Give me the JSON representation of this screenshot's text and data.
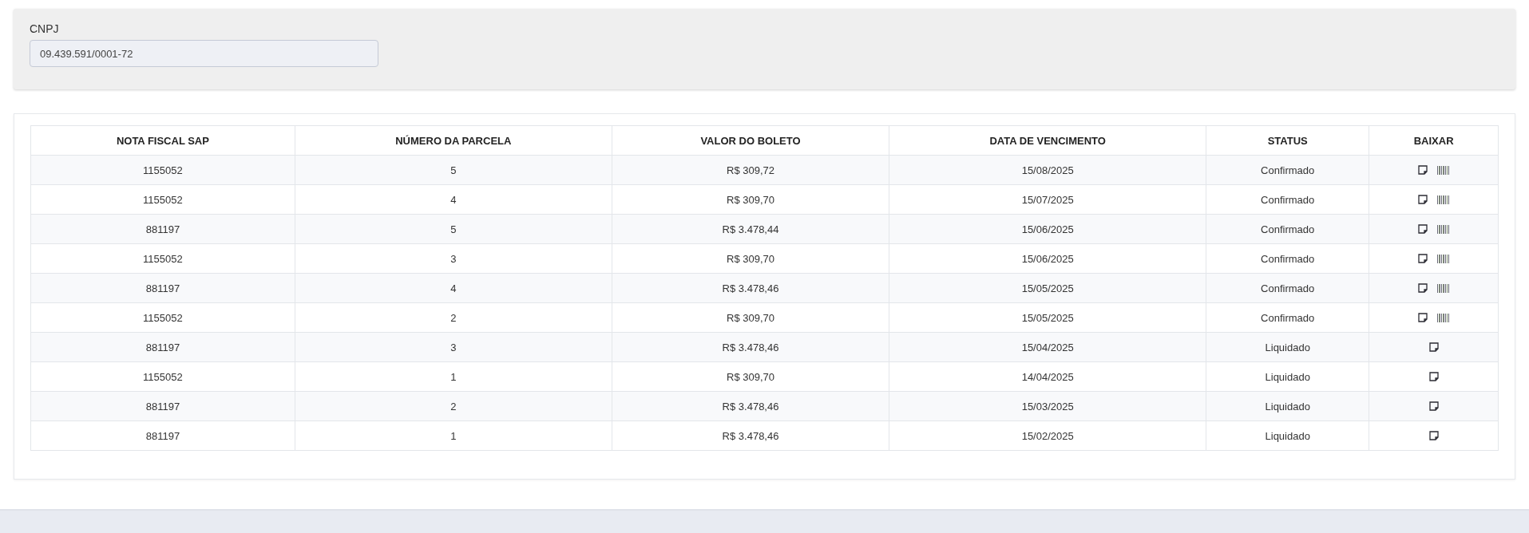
{
  "filter": {
    "label": "CNPJ",
    "value": "09.439.591/0001-72"
  },
  "table": {
    "columns": [
      "NOTA FISCAL SAP",
      "NÚMERO DA PARCELA",
      "VALOR DO BOLETO",
      "DATA DE VENCIMENTO",
      "STATUS",
      "BAIXAR"
    ],
    "rows": [
      {
        "cells": [
          "1155052",
          "5",
          "R$ 309,72",
          "15/08/2025",
          "Confirmado"
        ],
        "barcode": true
      },
      {
        "cells": [
          "1155052",
          "4",
          "R$ 309,70",
          "15/07/2025",
          "Confirmado"
        ],
        "barcode": true
      },
      {
        "cells": [
          "881197",
          "5",
          "R$ 3.478,44",
          "15/06/2025",
          "Confirmado"
        ],
        "barcode": true
      },
      {
        "cells": [
          "1155052",
          "3",
          "R$ 309,70",
          "15/06/2025",
          "Confirmado"
        ],
        "barcode": true
      },
      {
        "cells": [
          "881197",
          "4",
          "R$ 3.478,46",
          "15/05/2025",
          "Confirmado"
        ],
        "barcode": true
      },
      {
        "cells": [
          "1155052",
          "2",
          "R$ 309,70",
          "15/05/2025",
          "Confirmado"
        ],
        "barcode": true
      },
      {
        "cells": [
          "881197",
          "3",
          "R$ 3.478,46",
          "15/04/2025",
          "Liquidado"
        ],
        "barcode": false
      },
      {
        "cells": [
          "1155052",
          "1",
          "R$ 309,70",
          "14/04/2025",
          "Liquidado"
        ],
        "barcode": false
      },
      {
        "cells": [
          "881197",
          "2",
          "R$ 3.478,46",
          "15/03/2025",
          "Liquidado"
        ],
        "barcode": false
      },
      {
        "cells": [
          "881197",
          "1",
          "R$ 3.478,46",
          "15/02/2025",
          "Liquidado"
        ],
        "barcode": false
      }
    ]
  }
}
